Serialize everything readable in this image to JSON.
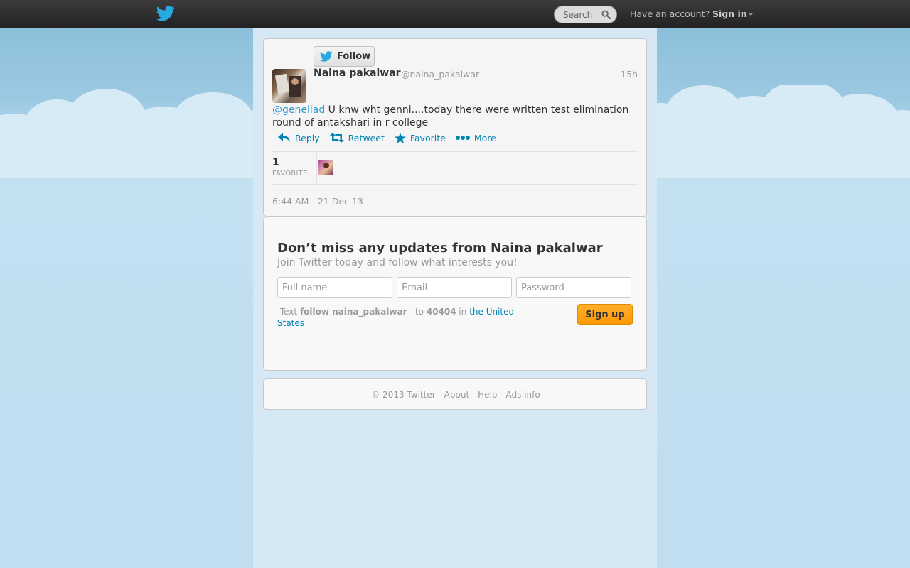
{
  "topbar": {
    "search_placeholder": "Search",
    "have_account": "Have an account?",
    "sign_in": "Sign in"
  },
  "tweet": {
    "follow_label": "Follow",
    "name": "Naina pakalwar",
    "handle": "@naina_pakalwar",
    "time": "15h",
    "mention": "@geneliad",
    "text": " U knw wht genni....today there were written test elimination round of antakshari in r college",
    "actions": {
      "reply": "Reply",
      "retweet": "Retweet",
      "favorite": "Favorite",
      "more": "More"
    },
    "favorites_count": "1",
    "favorites_label": "FAVORITE",
    "date": "6:44 AM - 21 Dec 13"
  },
  "signup": {
    "title": "Don’t miss any updates from Naina pakalwar",
    "subtitle": "Join Twitter today and follow what interests you!",
    "fullname_placeholder": "Full name",
    "email_placeholder": "Email",
    "password_placeholder": "Password",
    "sms_prefix": "Text",
    "sms_command": "follow naina_pakalwar",
    "sms_to": "to",
    "sms_number": "40404",
    "sms_in": "in",
    "sms_country": "the United States",
    "button": "Sign up"
  },
  "footer": {
    "copyright": "© 2013 Twitter",
    "about": "About",
    "help": "Help",
    "ads_info": "Ads info"
  },
  "colors": {
    "link": "#0084b4",
    "mention": "#2b9ccf",
    "signup_button": "#ff9800",
    "twitter_blue": "#1da1f2"
  }
}
